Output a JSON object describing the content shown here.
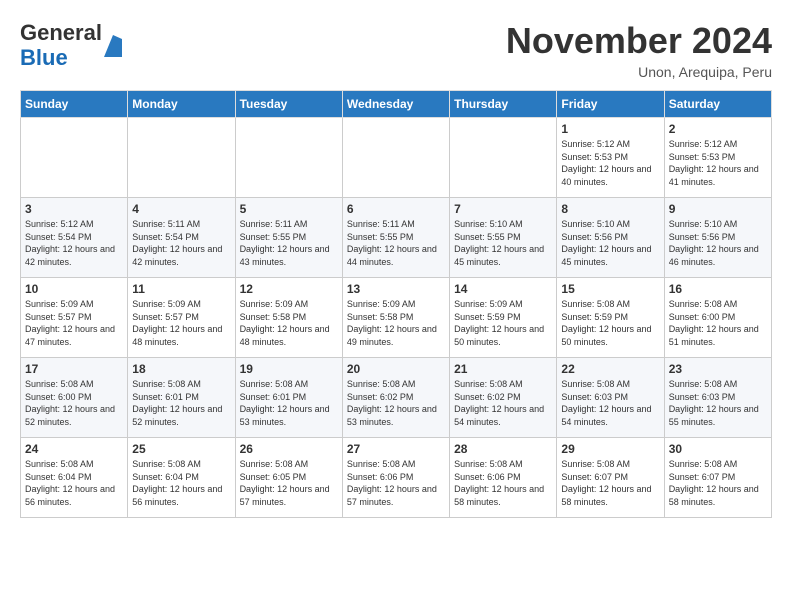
{
  "header": {
    "logo_general": "General",
    "logo_blue": "Blue",
    "month_title": "November 2024",
    "location": "Unon, Arequipa, Peru"
  },
  "weekdays": [
    "Sunday",
    "Monday",
    "Tuesday",
    "Wednesday",
    "Thursday",
    "Friday",
    "Saturday"
  ],
  "weeks": [
    [
      {
        "day": "",
        "info": ""
      },
      {
        "day": "",
        "info": ""
      },
      {
        "day": "",
        "info": ""
      },
      {
        "day": "",
        "info": ""
      },
      {
        "day": "",
        "info": ""
      },
      {
        "day": "1",
        "info": "Sunrise: 5:12 AM\nSunset: 5:53 PM\nDaylight: 12 hours and 40 minutes."
      },
      {
        "day": "2",
        "info": "Sunrise: 5:12 AM\nSunset: 5:53 PM\nDaylight: 12 hours and 41 minutes."
      }
    ],
    [
      {
        "day": "3",
        "info": "Sunrise: 5:12 AM\nSunset: 5:54 PM\nDaylight: 12 hours and 42 minutes."
      },
      {
        "day": "4",
        "info": "Sunrise: 5:11 AM\nSunset: 5:54 PM\nDaylight: 12 hours and 42 minutes."
      },
      {
        "day": "5",
        "info": "Sunrise: 5:11 AM\nSunset: 5:55 PM\nDaylight: 12 hours and 43 minutes."
      },
      {
        "day": "6",
        "info": "Sunrise: 5:11 AM\nSunset: 5:55 PM\nDaylight: 12 hours and 44 minutes."
      },
      {
        "day": "7",
        "info": "Sunrise: 5:10 AM\nSunset: 5:55 PM\nDaylight: 12 hours and 45 minutes."
      },
      {
        "day": "8",
        "info": "Sunrise: 5:10 AM\nSunset: 5:56 PM\nDaylight: 12 hours and 45 minutes."
      },
      {
        "day": "9",
        "info": "Sunrise: 5:10 AM\nSunset: 5:56 PM\nDaylight: 12 hours and 46 minutes."
      }
    ],
    [
      {
        "day": "10",
        "info": "Sunrise: 5:09 AM\nSunset: 5:57 PM\nDaylight: 12 hours and 47 minutes."
      },
      {
        "day": "11",
        "info": "Sunrise: 5:09 AM\nSunset: 5:57 PM\nDaylight: 12 hours and 48 minutes."
      },
      {
        "day": "12",
        "info": "Sunrise: 5:09 AM\nSunset: 5:58 PM\nDaylight: 12 hours and 48 minutes."
      },
      {
        "day": "13",
        "info": "Sunrise: 5:09 AM\nSunset: 5:58 PM\nDaylight: 12 hours and 49 minutes."
      },
      {
        "day": "14",
        "info": "Sunrise: 5:09 AM\nSunset: 5:59 PM\nDaylight: 12 hours and 50 minutes."
      },
      {
        "day": "15",
        "info": "Sunrise: 5:08 AM\nSunset: 5:59 PM\nDaylight: 12 hours and 50 minutes."
      },
      {
        "day": "16",
        "info": "Sunrise: 5:08 AM\nSunset: 6:00 PM\nDaylight: 12 hours and 51 minutes."
      }
    ],
    [
      {
        "day": "17",
        "info": "Sunrise: 5:08 AM\nSunset: 6:00 PM\nDaylight: 12 hours and 52 minutes."
      },
      {
        "day": "18",
        "info": "Sunrise: 5:08 AM\nSunset: 6:01 PM\nDaylight: 12 hours and 52 minutes."
      },
      {
        "day": "19",
        "info": "Sunrise: 5:08 AM\nSunset: 6:01 PM\nDaylight: 12 hours and 53 minutes."
      },
      {
        "day": "20",
        "info": "Sunrise: 5:08 AM\nSunset: 6:02 PM\nDaylight: 12 hours and 53 minutes."
      },
      {
        "day": "21",
        "info": "Sunrise: 5:08 AM\nSunset: 6:02 PM\nDaylight: 12 hours and 54 minutes."
      },
      {
        "day": "22",
        "info": "Sunrise: 5:08 AM\nSunset: 6:03 PM\nDaylight: 12 hours and 54 minutes."
      },
      {
        "day": "23",
        "info": "Sunrise: 5:08 AM\nSunset: 6:03 PM\nDaylight: 12 hours and 55 minutes."
      }
    ],
    [
      {
        "day": "24",
        "info": "Sunrise: 5:08 AM\nSunset: 6:04 PM\nDaylight: 12 hours and 56 minutes."
      },
      {
        "day": "25",
        "info": "Sunrise: 5:08 AM\nSunset: 6:04 PM\nDaylight: 12 hours and 56 minutes."
      },
      {
        "day": "26",
        "info": "Sunrise: 5:08 AM\nSunset: 6:05 PM\nDaylight: 12 hours and 57 minutes."
      },
      {
        "day": "27",
        "info": "Sunrise: 5:08 AM\nSunset: 6:06 PM\nDaylight: 12 hours and 57 minutes."
      },
      {
        "day": "28",
        "info": "Sunrise: 5:08 AM\nSunset: 6:06 PM\nDaylight: 12 hours and 58 minutes."
      },
      {
        "day": "29",
        "info": "Sunrise: 5:08 AM\nSunset: 6:07 PM\nDaylight: 12 hours and 58 minutes."
      },
      {
        "day": "30",
        "info": "Sunrise: 5:08 AM\nSunset: 6:07 PM\nDaylight: 12 hours and 58 minutes."
      }
    ]
  ]
}
